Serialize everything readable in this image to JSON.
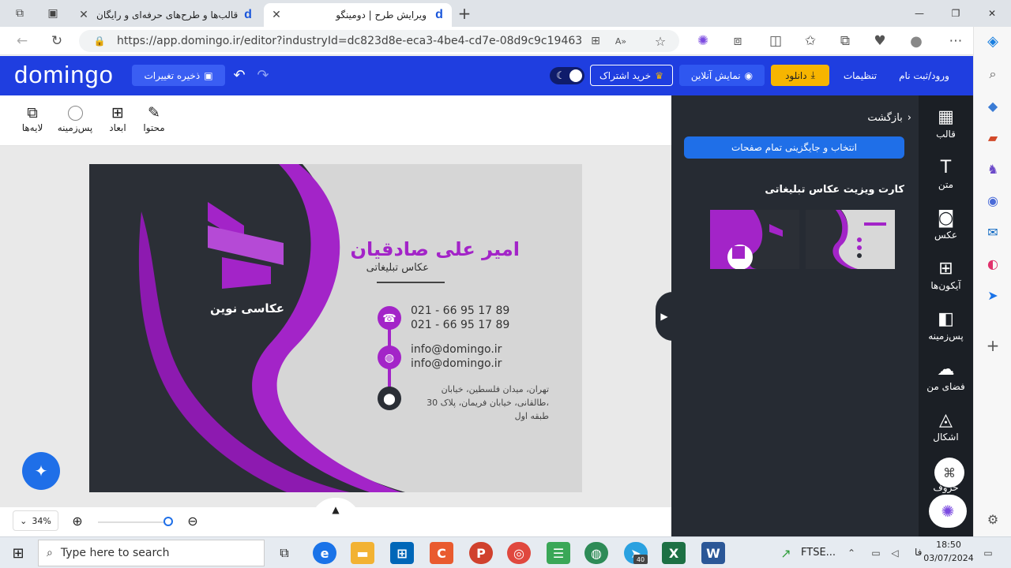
{
  "browser": {
    "tabs": [
      {
        "title": "قالب‌ها و طرح‌های حرفه‌ای و رایگان",
        "icon": "domingo-d-icon"
      },
      {
        "title": "ویرایش طرح | دومینگو",
        "icon": "domingo-d-icon"
      }
    ],
    "url": "https://app.domingo.ir/editor?industryId=dc823d8e-eca3-4be4-cd7e-08d9c9c19463",
    "new_tab": "+",
    "window_controls": [
      "—",
      "❐",
      "✕"
    ]
  },
  "app": {
    "logo": "domingo",
    "save_label": "ذخیره تغییرات",
    "buy_label": "خرید اشتراک",
    "preview_label": "نمایش آنلاین",
    "download_label": "دانلود",
    "settings_label": "تنظیمات",
    "login_label": "ورود/ثبت نام",
    "accent": "#1f3ee0",
    "download_color": "#f7b500"
  },
  "toolbar": {
    "content": "محتوا",
    "dimensions": "ابعاد",
    "background": "پس‌زمینه",
    "layers": "لایه‌ها"
  },
  "card": {
    "name": "امیر علی صادقیان",
    "title": "عکاس تبلیغاتی",
    "brand": "عکاسی نوین",
    "phones": [
      "021 - 66 95 17 89",
      "021 - 66 95 17 89"
    ],
    "emails": [
      "info@domingo.ir",
      "info@domingo.ir"
    ],
    "address_lines": [
      "تهران، میدان فلسطین، خیابان",
      "طالقانی، خیابان فریمان، پلاک 30،",
      "طبقه اول"
    ],
    "purple": "#a324c8"
  },
  "zoom": {
    "value": "34%"
  },
  "panel": {
    "back": "بازگشت",
    "replace_all": "انتخاب و جایگزینی تمام صفحات",
    "section_title": "کارت ویزیت عکاس تبلیغاتی"
  },
  "rail": [
    {
      "label": "قالب",
      "icon": "template-icon"
    },
    {
      "label": "متن",
      "icon": "text-icon"
    },
    {
      "label": "عکس",
      "icon": "image-icon"
    },
    {
      "label": "آیکون‌ها",
      "icon": "icons-grid-icon"
    },
    {
      "label": "پس‌زمینه",
      "icon": "background-icon"
    },
    {
      "label": "فضای من",
      "icon": "upload-cloud-icon"
    },
    {
      "label": "اشکال",
      "icon": "shapes-icon"
    },
    {
      "label": "حروف",
      "icon": "letters-icon"
    }
  ],
  "taskbar": {
    "search_placeholder": "Type here to search",
    "ticker": "FTSE...",
    "lang": "فا",
    "time": "18:50",
    "date": "03/07/2024",
    "badge": "40"
  }
}
